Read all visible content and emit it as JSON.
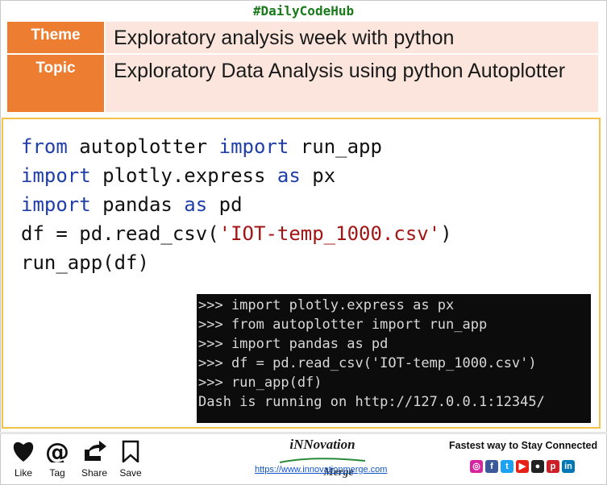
{
  "header": {
    "hashtag": "#DailyCodeHub",
    "theme_label": "Theme",
    "theme_value": "Exploratory analysis week with python",
    "topic_label": "Topic",
    "topic_value": "Exploratory Data Analysis using python Autoplotter"
  },
  "code": {
    "lines": [
      [
        {
          "t": "from",
          "c": "kw"
        },
        {
          "t": " autoplotter "
        },
        {
          "t": "import",
          "c": "kw"
        },
        {
          "t": " run_app"
        }
      ],
      [
        {
          "t": "import",
          "c": "kw"
        },
        {
          "t": " plotly.express "
        },
        {
          "t": "as",
          "c": "kw"
        },
        {
          "t": " px"
        }
      ],
      [
        {
          "t": "import",
          "c": "kw"
        },
        {
          "t": " pandas "
        },
        {
          "t": "as",
          "c": "kw"
        },
        {
          "t": " pd"
        }
      ],
      [
        {
          "t": "df = pd.read_csv("
        },
        {
          "t": "'IOT-temp_1000.csv'",
          "c": "str"
        },
        {
          "t": ")"
        }
      ],
      [
        {
          "t": "run_app(df)"
        }
      ]
    ]
  },
  "terminal": {
    "lines": [
      ">>> import plotly.express as px",
      ">>> from autoplotter import run_app",
      ">>> import pandas as pd",
      ">>> df = pd.read_csv('IOT-temp_1000.csv')",
      ">>> run_app(df)",
      "Dash is running on http://127.0.0.1:12345/"
    ]
  },
  "footer": {
    "actions": [
      {
        "label": "Like",
        "icon": "heart-icon"
      },
      {
        "label": "Tag",
        "icon": "at-icon"
      },
      {
        "label": "Share",
        "icon": "share-icon"
      },
      {
        "label": "Save",
        "icon": "bookmark-icon"
      }
    ],
    "brand_name": "iNNovation",
    "brand_sub": "Merge",
    "url": "https://www.innovationmerge.com",
    "tagline": "Fastest way to Stay Connected",
    "socials": [
      {
        "icon": "instagram-icon",
        "glyph": "◎",
        "color": "#d6249f"
      },
      {
        "icon": "facebook-icon",
        "glyph": "f",
        "color": "#3b5998"
      },
      {
        "icon": "twitter-icon",
        "glyph": "t",
        "color": "#1da1f2"
      },
      {
        "icon": "youtube-icon",
        "glyph": "▶",
        "color": "#e62117"
      },
      {
        "icon": "github-icon",
        "glyph": "●",
        "color": "#222222"
      },
      {
        "icon": "pinterest-icon",
        "glyph": "p",
        "color": "#cb2027"
      },
      {
        "icon": "linkedin-icon",
        "glyph": "in",
        "color": "#0077b5"
      }
    ]
  }
}
